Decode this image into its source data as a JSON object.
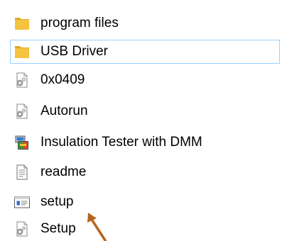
{
  "files": [
    {
      "name": "program files",
      "icon": "folder-icon",
      "selected": false
    },
    {
      "name": "USB Driver",
      "icon": "folder-icon",
      "selected": true
    },
    {
      "name": "0x0409",
      "icon": "config-settings-icon",
      "selected": false
    },
    {
      "name": "Autorun",
      "icon": "config-settings-icon",
      "selected": false
    },
    {
      "name": "Insulation Tester with DMM",
      "icon": "installer-package-icon",
      "selected": false
    },
    {
      "name": "readme",
      "icon": "text-document-icon",
      "selected": false
    },
    {
      "name": "setup",
      "icon": "application-window-icon",
      "selected": false
    },
    {
      "name": "Setup",
      "icon": "config-settings-icon",
      "selected": false
    }
  ],
  "colors": {
    "folder": "#f5c242",
    "folder_dark": "#dea92a",
    "selection_border": "#99d1ff",
    "annotation_arrow": "#b5651d",
    "text": "#000000"
  },
  "annotation": {
    "icon": "arrow-annotation-icon",
    "points_to": "setup"
  }
}
